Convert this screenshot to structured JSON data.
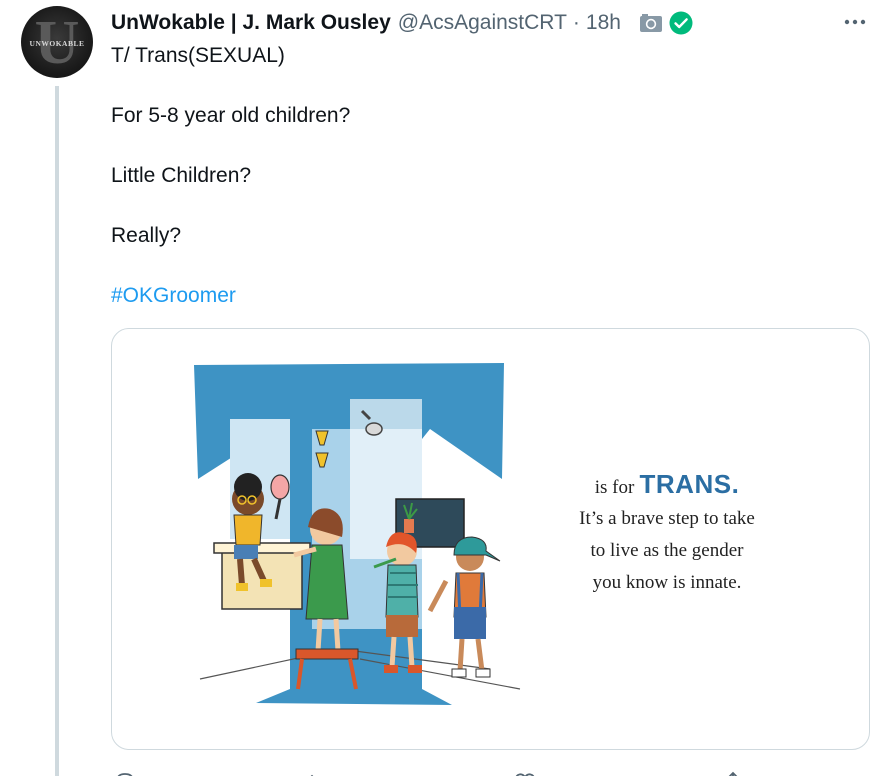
{
  "author": {
    "display_name": "UnWokable | J. Mark Ousley",
    "handle": "@AcsAgainstCRT",
    "separator": "·",
    "time": "18h",
    "avatar_text": "UNWOKABLE",
    "avatar_letter": "U"
  },
  "icons": {
    "camera": "camera-icon",
    "verified": "verified-check-icon",
    "more": "more-horizontal-icon",
    "reply": "reply-icon",
    "retweet": "retweet-icon",
    "like": "heart-icon",
    "share": "share-icon"
  },
  "tweet": {
    "lines": [
      "T/ Trans(SEXUAL)",
      "For 5-8 year old children?",
      "Little Children?",
      "Really?"
    ],
    "hashtag": "#OKGroomer"
  },
  "media": {
    "caption_prefix": "is for",
    "caption_word": "TRANS.",
    "caption_lines": [
      "It’s a brave step to take",
      "to live as the gender",
      "you know is innate."
    ]
  },
  "colors": {
    "link": "#1d9bf0",
    "verified": "#00ba7c",
    "letter_blue": "#3e93c4",
    "caption_blue": "#2b6ea3"
  }
}
